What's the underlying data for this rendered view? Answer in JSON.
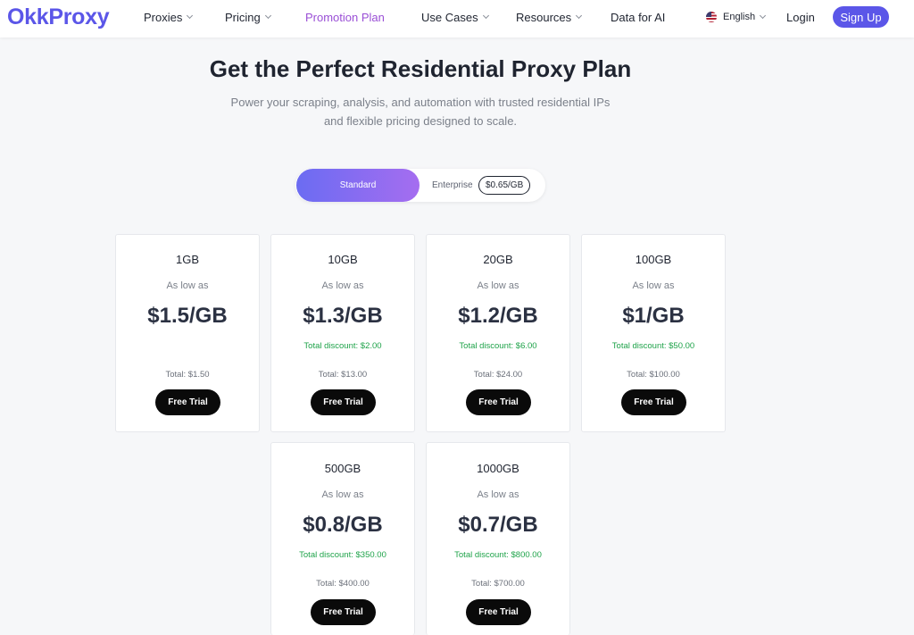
{
  "header": {
    "logo": "OkkProxy",
    "nav": [
      "Proxies",
      "Pricing",
      "Promotion Plan",
      "Use Cases",
      "Resources",
      "Data for AI"
    ],
    "language": "English",
    "login": "Login",
    "signup": "Sign Up",
    "active_color": "#9a4fd6",
    "brand_color": "#5b56e8"
  },
  "hero": {
    "title": "Get the Perfect Residential Proxy Plan",
    "subtitle_line1": "Power your scraping, analysis, and automation with trusted residential IPs",
    "subtitle_line2": "and flexible pricing designed to scale."
  },
  "toggle": {
    "standard": "Standard",
    "enterprise": "Enterprise",
    "enterprise_price": "$0.65/GB"
  },
  "plans": [
    {
      "size": "1GB",
      "as_low_as": "As low as",
      "price": "$1.5/GB",
      "discount": "",
      "total": "Total: $1.50",
      "button": "Free Trial"
    },
    {
      "size": "10GB",
      "as_low_as": "As low as",
      "price": "$1.3/GB",
      "discount": "Total discount: $2.00",
      "total": "Total: $13.00",
      "button": "Free Trial"
    },
    {
      "size": "20GB",
      "as_low_as": "As low as",
      "price": "$1.2/GB",
      "discount": "Total discount: $6.00",
      "total": "Total: $24.00",
      "button": "Free Trial"
    },
    {
      "size": "100GB",
      "as_low_as": "As low as",
      "price": "$1/GB",
      "discount": "Total discount: $50.00",
      "total": "Total: $100.00",
      "button": "Free Trial"
    },
    {
      "size": "500GB",
      "as_low_as": "As low as",
      "price": "$0.8/GB",
      "discount": "Total discount: $350.00",
      "total": "Total: $400.00",
      "button": "Free Trial"
    },
    {
      "size": "1000GB",
      "as_low_as": "As low as",
      "price": "$0.7/GB",
      "discount": "Total discount: $800.00",
      "total": "Total: $700.00",
      "button": "Free Trial"
    }
  ]
}
